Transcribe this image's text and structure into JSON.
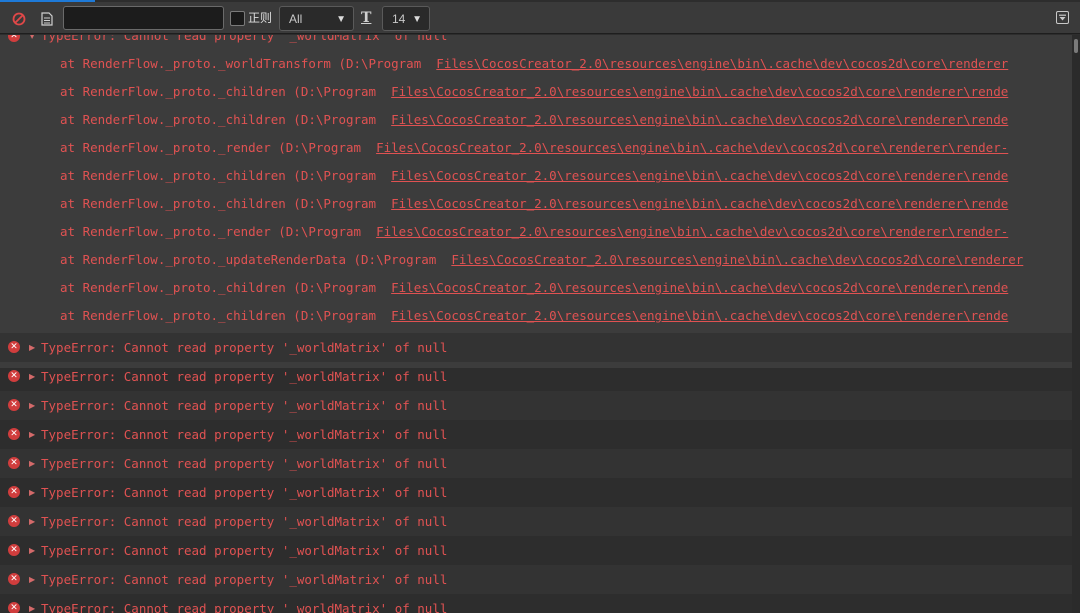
{
  "toolbar": {
    "search_value": "",
    "regex_label": "正则",
    "level_select": "All",
    "font_size": "14",
    "icons": [
      "clear-icon",
      "document-icon",
      "font-icon",
      "collapse-icon"
    ]
  },
  "colors": {
    "error_text": "#e05252",
    "toolbar_bg": "#3a3a3a",
    "log_bg": "#2d2d2d",
    "expanded_bg": "#3c3c3c"
  },
  "expanded_entry": {
    "message": "TypeError: Cannot read property '_worldMatrix' of null",
    "stack": [
      {
        "prefix": "at RenderFlow._proto._worldTransform (D:\\Program ",
        "link": "Files\\CocosCreator_2.0\\resources\\engine\\bin\\.cache\\dev\\cocos2d\\core\\renderer"
      },
      {
        "prefix": "at RenderFlow._proto._children (D:\\Program ",
        "link": "Files\\CocosCreator_2.0\\resources\\engine\\bin\\.cache\\dev\\cocos2d\\core\\renderer\\rende"
      },
      {
        "prefix": "at RenderFlow._proto._children (D:\\Program ",
        "link": "Files\\CocosCreator_2.0\\resources\\engine\\bin\\.cache\\dev\\cocos2d\\core\\renderer\\rende"
      },
      {
        "prefix": "at RenderFlow._proto._render (D:\\Program ",
        "link": "Files\\CocosCreator_2.0\\resources\\engine\\bin\\.cache\\dev\\cocos2d\\core\\renderer\\render-"
      },
      {
        "prefix": "at RenderFlow._proto._children (D:\\Program ",
        "link": "Files\\CocosCreator_2.0\\resources\\engine\\bin\\.cache\\dev\\cocos2d\\core\\renderer\\rende"
      },
      {
        "prefix": "at RenderFlow._proto._children (D:\\Program ",
        "link": "Files\\CocosCreator_2.0\\resources\\engine\\bin\\.cache\\dev\\cocos2d\\core\\renderer\\rende"
      },
      {
        "prefix": "at RenderFlow._proto._render (D:\\Program ",
        "link": "Files\\CocosCreator_2.0\\resources\\engine\\bin\\.cache\\dev\\cocos2d\\core\\renderer\\render-"
      },
      {
        "prefix": "at RenderFlow._proto._updateRenderData (D:\\Program ",
        "link": "Files\\CocosCreator_2.0\\resources\\engine\\bin\\.cache\\dev\\cocos2d\\core\\renderer"
      },
      {
        "prefix": "at RenderFlow._proto._children (D:\\Program ",
        "link": "Files\\CocosCreator_2.0\\resources\\engine\\bin\\.cache\\dev\\cocos2d\\core\\renderer\\rende"
      },
      {
        "prefix": "at RenderFlow._proto._children (D:\\Program ",
        "link": "Files\\CocosCreator_2.0\\resources\\engine\\bin\\.cache\\dev\\cocos2d\\core\\renderer\\rende"
      }
    ]
  },
  "collapsed_entries": [
    "TypeError: Cannot read property '_worldMatrix' of null",
    "TypeError: Cannot read property '_worldMatrix' of null",
    "TypeError: Cannot read property '_worldMatrix' of null",
    "TypeError: Cannot read property '_worldMatrix' of null",
    "TypeError: Cannot read property '_worldMatrix' of null",
    "TypeError: Cannot read property '_worldMatrix' of null",
    "TypeError: Cannot read property '_worldMatrix' of null",
    "TypeError: Cannot read property '_worldMatrix' of null",
    "TypeError: Cannot read property '_worldMatrix' of null",
    "TypeError: Cannot read property '_worldMatrix' of null"
  ]
}
